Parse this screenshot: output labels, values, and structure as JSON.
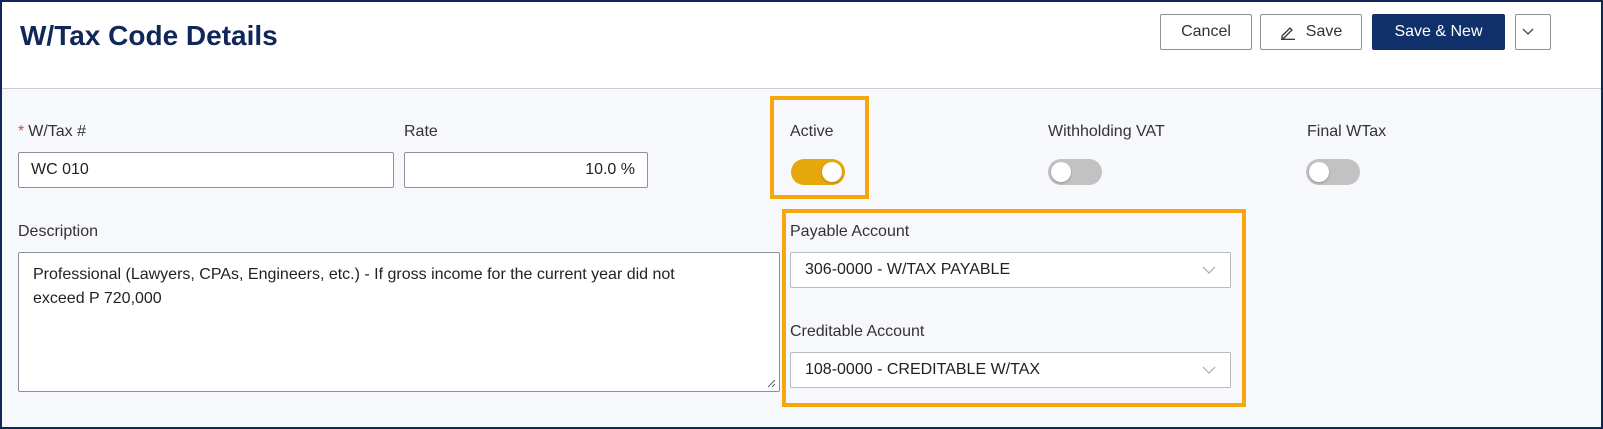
{
  "header": {
    "title": "W/Tax Code Details",
    "cancel_label": "Cancel",
    "save_label": "Save",
    "save_new_label": "Save & New"
  },
  "form": {
    "wtax_no": {
      "label": "W/Tax #",
      "required_mark": "*",
      "value": "WC 010"
    },
    "rate": {
      "label": "Rate",
      "value": "10.0 %"
    },
    "active": {
      "label": "Active",
      "on": true
    },
    "withholding_vat": {
      "label": "Withholding VAT",
      "on": false
    },
    "final_wtax": {
      "label": "Final WTax",
      "on": false
    },
    "description": {
      "label": "Description",
      "value": "Professional (Lawyers, CPAs, Engineers, etc.) - If gross income for the current year did not exceed P 720,000"
    },
    "payable_account": {
      "label": "Payable Account",
      "value": "306-0000 - W/TAX PAYABLE"
    },
    "creditable_account": {
      "label": "Creditable Account",
      "value": "108-0000 - CREDITABLE W/TAX"
    }
  },
  "colors": {
    "brand_navy": "#10275a",
    "primary_button": "#10306a",
    "toggle_on": "#e6a70b",
    "toggle_off": "#c2c2c2",
    "highlight": "#f5a70d",
    "required": "#e0453a"
  },
  "icons": {
    "save": "pencil-icon",
    "dropdown": "chevron-down-icon",
    "resize": "resize-handle-icon"
  }
}
